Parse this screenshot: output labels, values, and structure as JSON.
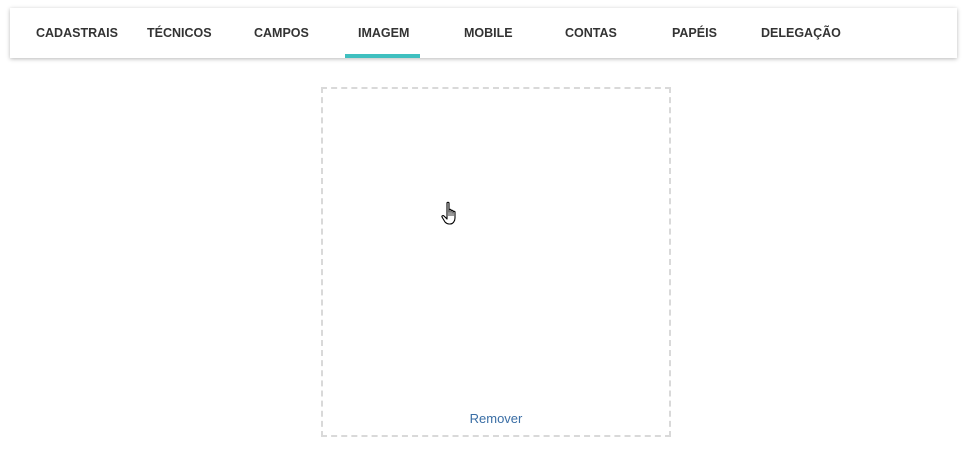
{
  "tabs": [
    {
      "id": "cadastrais",
      "label": "CADASTRAIS"
    },
    {
      "id": "tecnicos",
      "label": "TÉCNICOS"
    },
    {
      "id": "campos",
      "label": "CAMPOS"
    },
    {
      "id": "imagem",
      "label": "IMAGEM"
    },
    {
      "id": "mobile",
      "label": "MOBILE"
    },
    {
      "id": "contas",
      "label": "CONTAS"
    },
    {
      "id": "papeis",
      "label": "PAPÉIS"
    },
    {
      "id": "delegacao",
      "label": "DELEGAÇÃO"
    }
  ],
  "active_tab": "IMAGEM",
  "image_panel": {
    "remove_label": "Remover"
  },
  "colors": {
    "tab_indicator": "#3fbfbf",
    "link": "#3a6ea5",
    "dropzone_border": "#d9d9d9"
  },
  "icons": {
    "cursor": "hand-pointer-icon"
  }
}
